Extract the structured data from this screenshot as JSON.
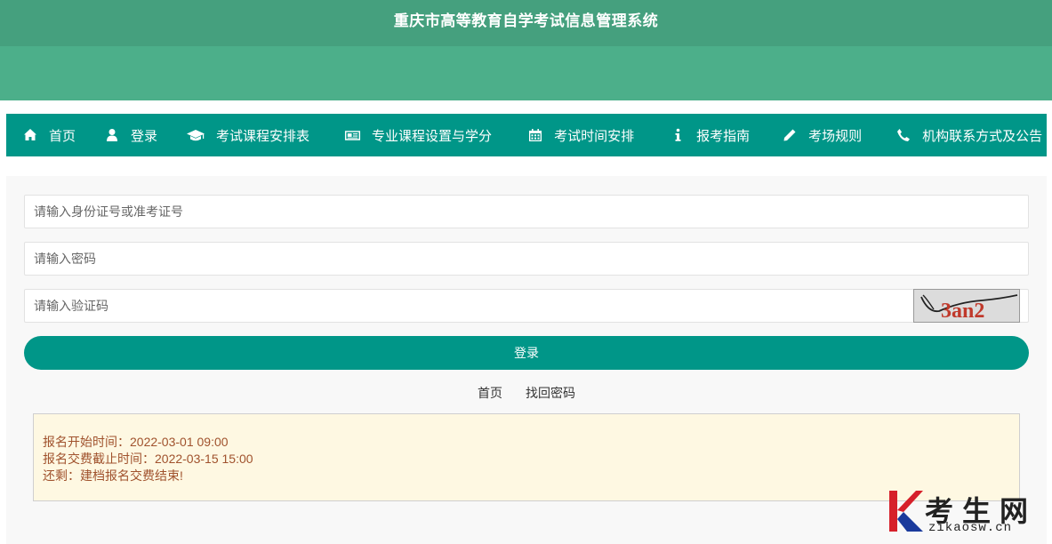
{
  "header": {
    "title": "重庆市高等教育自学考试信息管理系统"
  },
  "nav": {
    "items": [
      {
        "label": "首页",
        "icon": "home-icon"
      },
      {
        "label": "登录",
        "icon": "user-icon"
      },
      {
        "label": "考试课程安排表",
        "icon": "graduation-cap-icon"
      },
      {
        "label": "专业课程设置与学分",
        "icon": "newspaper-icon"
      },
      {
        "label": "考试时间安排",
        "icon": "calendar-icon"
      },
      {
        "label": "报考指南",
        "icon": "info-icon"
      },
      {
        "label": "考场规则",
        "icon": "pencil-icon"
      },
      {
        "label": "机构联系方式及公告",
        "icon": "phone-icon"
      }
    ]
  },
  "form": {
    "id_placeholder": "请输入身份证号或准考证号",
    "password_placeholder": "请输入密码",
    "captcha_placeholder": "请输入验证码",
    "captcha_text": "3an2",
    "login_label": "登录"
  },
  "links": {
    "home": "首页",
    "recover_password": "找回密码"
  },
  "notice": {
    "line1": "报名开始时间：2022-03-01 09:00",
    "line2": "报名交费截止时间：2022-03-15 15:00",
    "line3": "还剩：建档报名交费结束!"
  },
  "watermark": {
    "brand_cn": "考生网",
    "brand_en": "zikaosw.cn"
  },
  "colors": {
    "header": "#4caf8a",
    "nav": "#009688",
    "accent": "#009688",
    "notice_bg": "#fef8e2",
    "notice_text": "#a0522d"
  }
}
